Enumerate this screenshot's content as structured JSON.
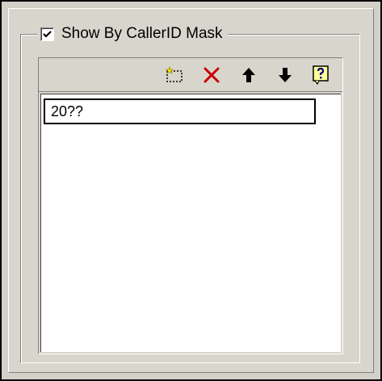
{
  "group": {
    "checkbox_checked": true,
    "label": "Show By CallerID Mask"
  },
  "toolbar": {
    "items": [
      {
        "icon": "new-item-icon"
      },
      {
        "icon": "delete-icon",
        "color": "#cc0000"
      },
      {
        "icon": "move-up-icon"
      },
      {
        "icon": "move-down-icon"
      },
      {
        "icon": "help-icon",
        "color": "#ffff99"
      }
    ]
  },
  "list": {
    "items": [
      "20??"
    ]
  }
}
